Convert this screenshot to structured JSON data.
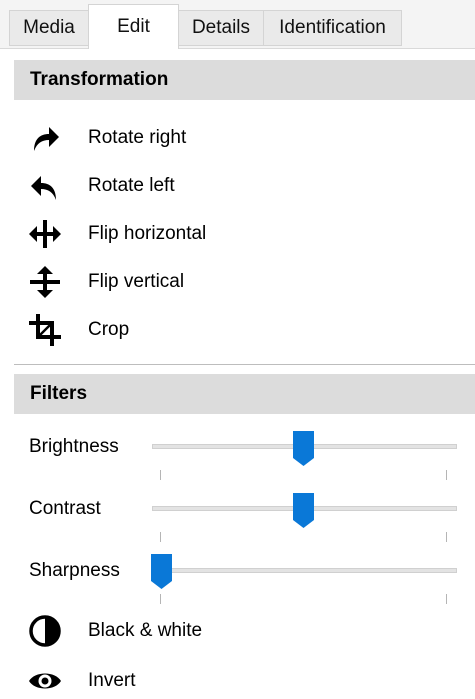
{
  "tabs": [
    {
      "label": "Media"
    },
    {
      "label": "Edit"
    },
    {
      "label": "Details"
    },
    {
      "label": "Identification"
    }
  ],
  "transformation": {
    "title": "Transformation",
    "actions": [
      {
        "icon": "rotate-right-icon",
        "label": "Rotate right"
      },
      {
        "icon": "rotate-left-icon",
        "label": "Rotate left"
      },
      {
        "icon": "flip-horizontal-icon",
        "label": "Flip horizontal"
      },
      {
        "icon": "flip-vertical-icon",
        "label": "Flip vertical"
      },
      {
        "icon": "crop-icon",
        "label": "Crop"
      }
    ]
  },
  "filters": {
    "title": "Filters",
    "sliders": [
      {
        "label": "Brightness",
        "value": 0.5
      },
      {
        "label": "Contrast",
        "value": 0.5
      },
      {
        "label": "Sharpness",
        "value": 0.0
      }
    ],
    "actions": [
      {
        "icon": "contrast-circle-icon",
        "label": "Black & white"
      },
      {
        "icon": "eye-icon",
        "label": "Invert"
      }
    ]
  },
  "colors": {
    "accent": "#0a78d7",
    "header_bg": "#dcdcdc"
  }
}
